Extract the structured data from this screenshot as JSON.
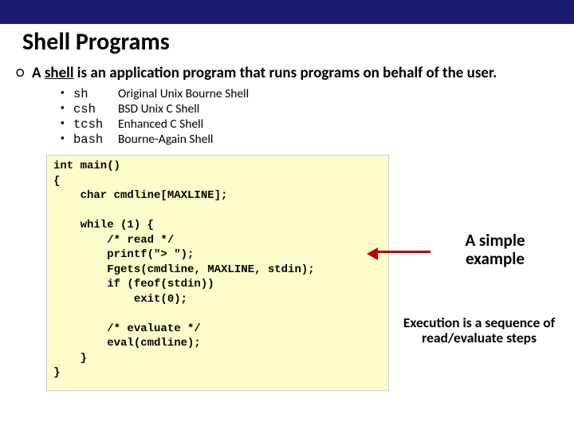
{
  "title": "Shell Programs",
  "intro": {
    "pre": "A ",
    "emph": "shell",
    "post": " is an application program that runs programs on behalf of the user."
  },
  "shells": [
    {
      "cmd": "sh",
      "desc": "Original Unix Bourne Shell"
    },
    {
      "cmd": "csh",
      "desc": "BSD Unix C Shell"
    },
    {
      "cmd": "tcsh",
      "desc": "Enhanced C Shell"
    },
    {
      "cmd": "bash",
      "desc": "Bourne-Again Shell"
    }
  ],
  "code": "int main()\n{\n    char cmdline[MAXLINE];\n\n    while (1) {\n        /* read */\n        printf(\"> \");\n        Fgets(cmdline, MAXLINE, stdin);\n        if (feof(stdin))\n            exit(0);\n\n        /* evaluate */\n        eval(cmdline);\n    }\n}",
  "annot1": "A simple example",
  "annot2": "Execution is a sequence of read/evaluate steps"
}
